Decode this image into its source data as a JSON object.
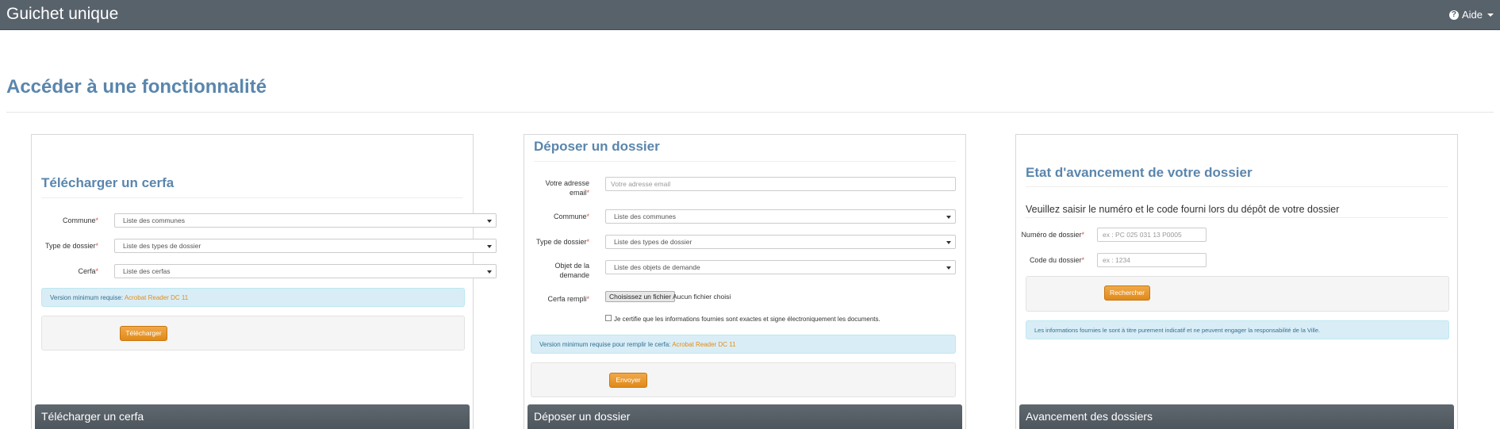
{
  "navbar": {
    "brand": "Guichet unique",
    "help_label": "Aide"
  },
  "page": {
    "title": "Accéder à une fonctionnalité"
  },
  "panels": {
    "telecharger": {
      "title": "Télécharger un cerfa",
      "fields": [
        {
          "label": "Commune",
          "required": "*",
          "value": "Liste des communes"
        },
        {
          "label": "Type de dossier",
          "required": "*",
          "value": "Liste des types de dossier"
        },
        {
          "label": "Cerfa",
          "required": "*",
          "value": "Liste des cerfas"
        }
      ],
      "info_text": "Version minimum requise: ",
      "info_link": "Acrobat Reader DC 11",
      "button": "Télécharger",
      "footer": "Télécharger un cerfa"
    },
    "deposer": {
      "title": "Déposer un dossier",
      "email_label_1": "Votre adresse",
      "email_label_2": "email",
      "email_required": "*",
      "email_placeholder": "Votre adresse email",
      "fields": [
        {
          "label": "Commune",
          "required": "*",
          "value": "Liste des communes"
        },
        {
          "label": "Type de dossier",
          "required": "*",
          "value": "Liste des types de dossier"
        }
      ],
      "objet_label_1": "Objet de la",
      "objet_label_2": "demande",
      "objet_value": "Liste des objets de demande",
      "cerfa_label": "Cerfa rempli",
      "cerfa_required": "*",
      "file_button": "Choisissez un fichier",
      "file_status": "Aucun fichier choisi",
      "certify_text": "Je certifie que les informations fournies sont exactes et signe électroniquement les documents.",
      "info_text": "Version minimum requise pour remplir le cerfa: ",
      "info_link": "Acrobat Reader DC 11",
      "button": "Envoyer",
      "footer": "Déposer un dossier"
    },
    "avancement": {
      "title": "Etat d'avancement de votre dossier",
      "subtitle": "Veuillez saisir le numéro et le code fourni lors du dépôt de votre dossier",
      "numero_label": "Numéro de dossier",
      "numero_required": "*",
      "numero_placeholder": "ex : PC 025 031 13 P0005",
      "code_label": "Code du dossier",
      "code_required": "*",
      "code_placeholder": "ex : 1234",
      "button": "Rechercher",
      "info_text": "Les informations fournies le sont à titre purement indicatif et ne peuvent engager la responsabilité de la Ville.",
      "footer": "Avancement des dossiers"
    }
  }
}
